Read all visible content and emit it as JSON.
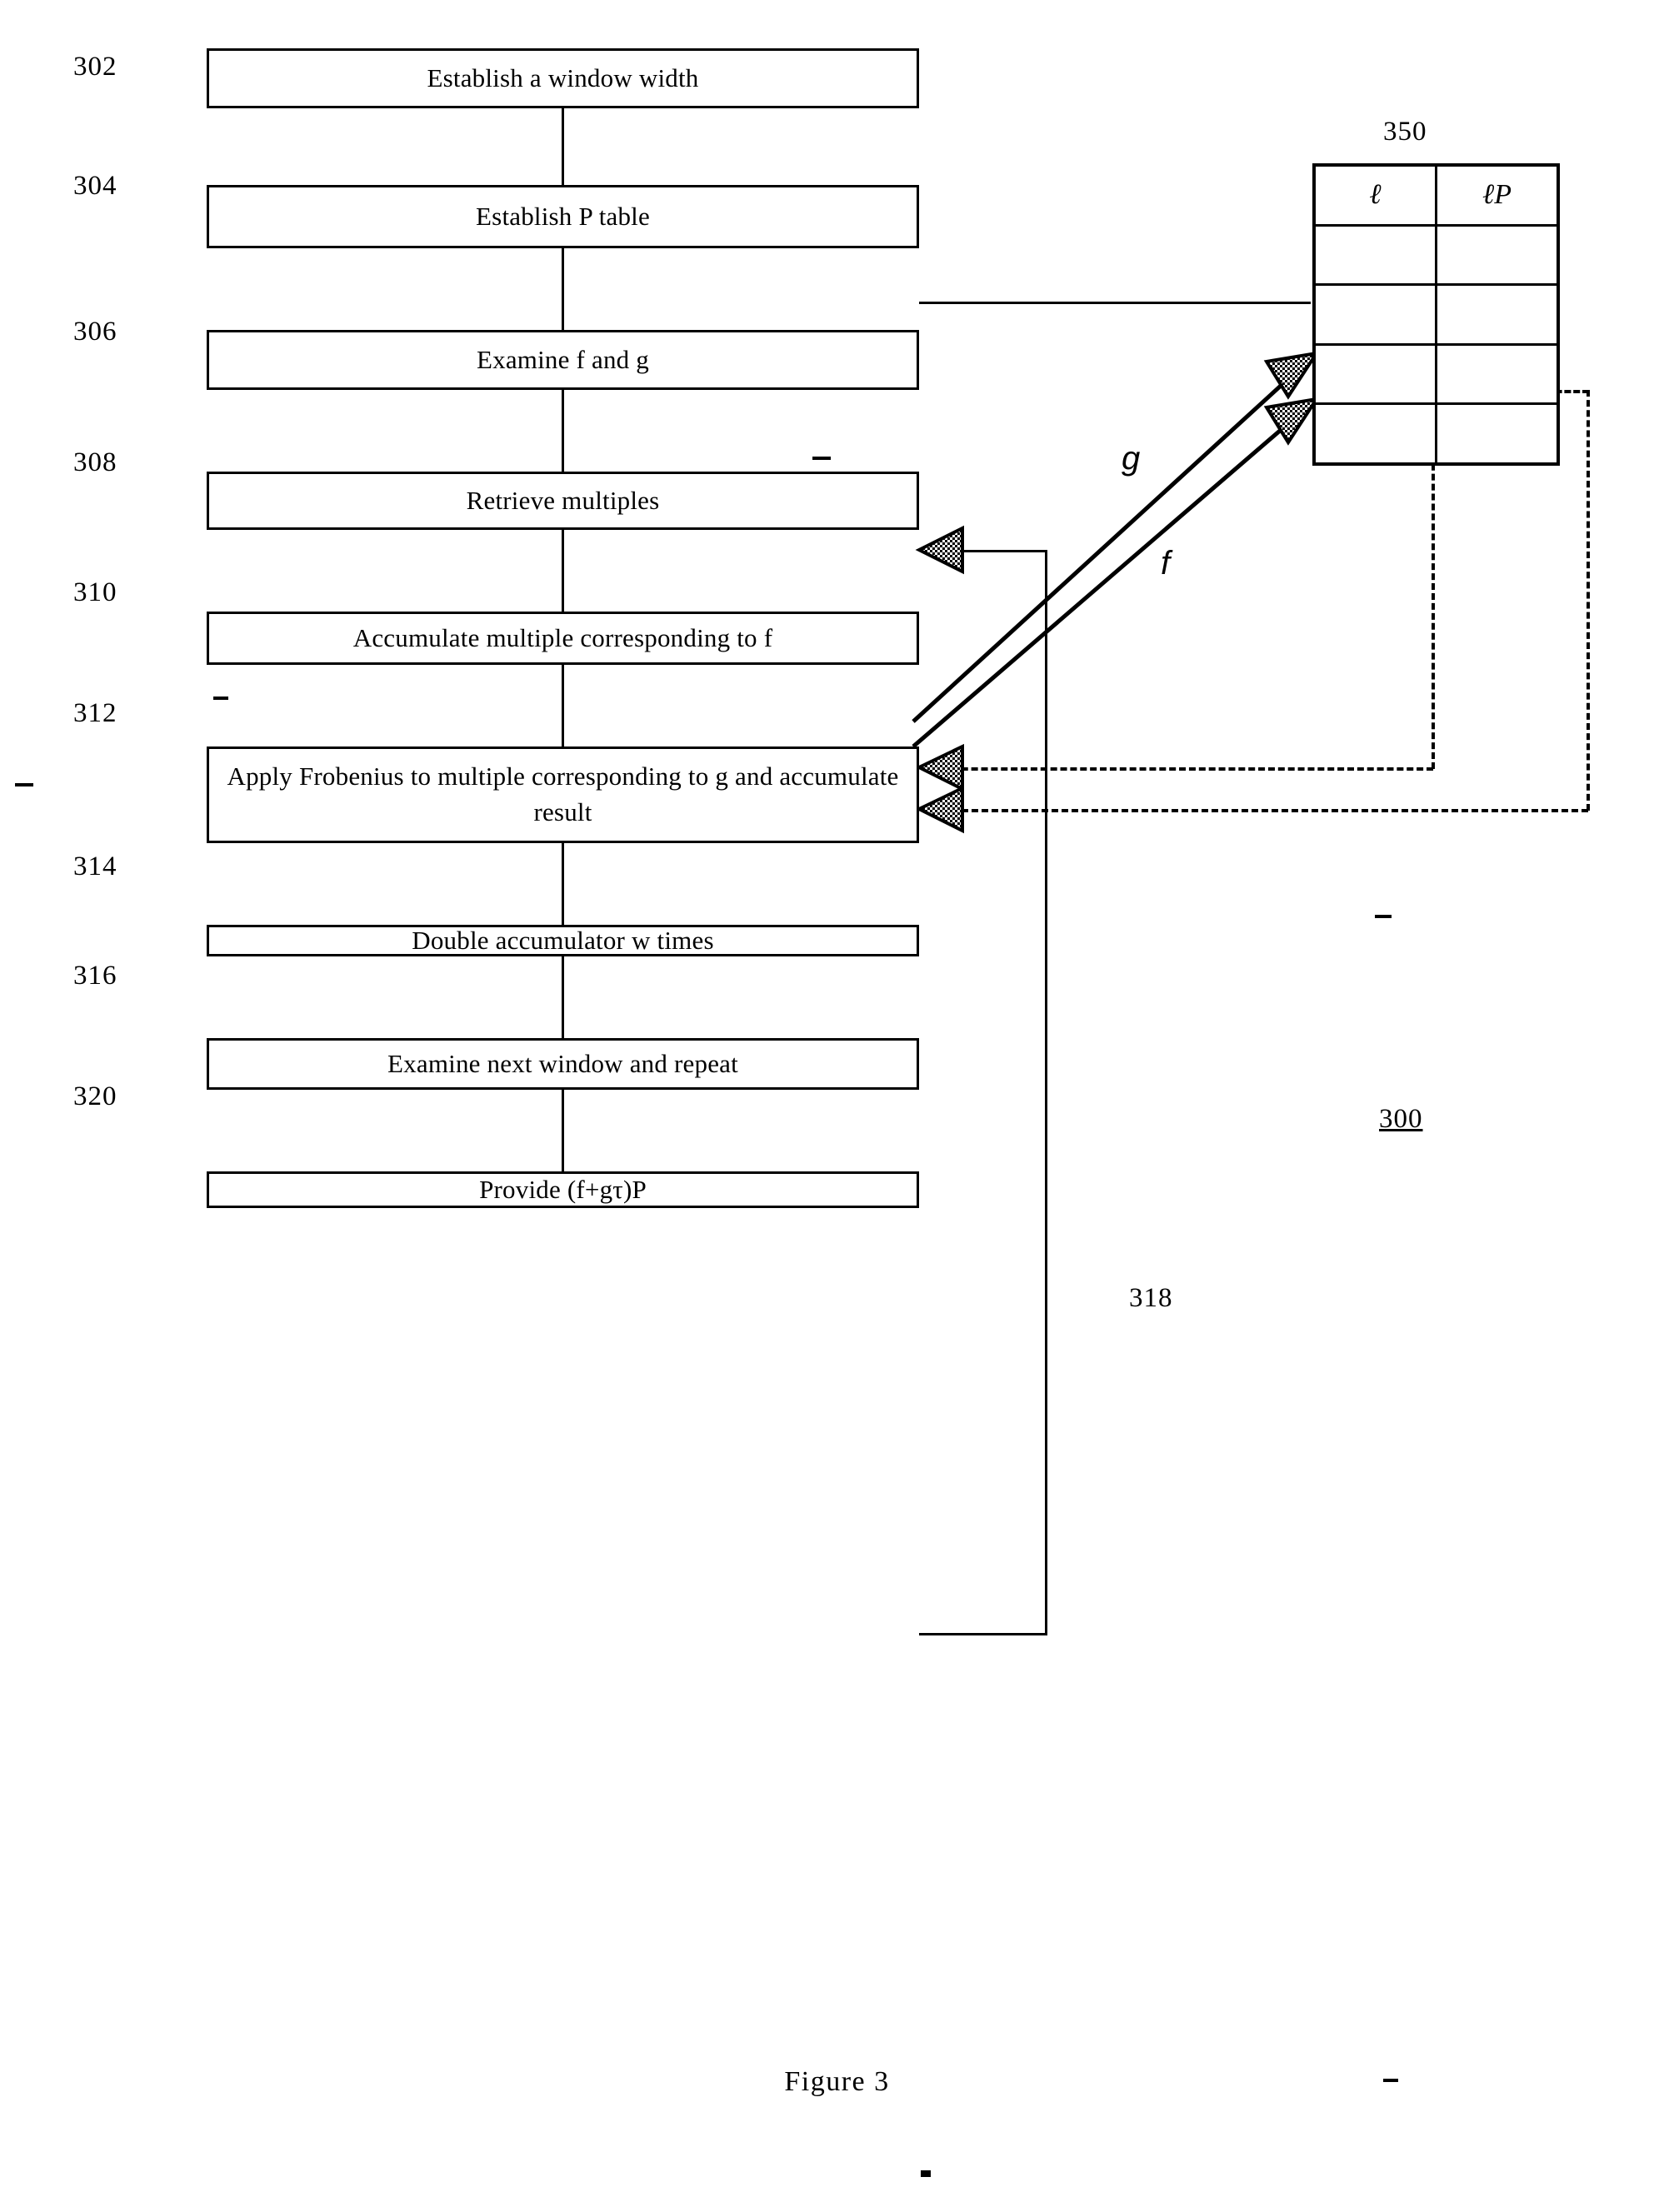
{
  "figure": {
    "caption": "Figure 3",
    "diagram_label": "300"
  },
  "flow_steps": [
    {
      "ref": "302",
      "text": "Establish a window width"
    },
    {
      "ref": "304",
      "text": "Establish P table"
    },
    {
      "ref": "306",
      "text": "Examine f and g"
    },
    {
      "ref": "308",
      "text": "Retrieve multiples"
    },
    {
      "ref": "310",
      "text": "Accumulate multiple corresponding to f"
    },
    {
      "ref": "312",
      "text": "Apply Frobenius to multiple corresponding to g and accumulate result"
    },
    {
      "ref": "314",
      "text": "Double accumulator w times"
    },
    {
      "ref": "316",
      "text": "Examine next window and repeat"
    },
    {
      "ref": "320",
      "text": "Provide (f+gτ)P"
    }
  ],
  "table": {
    "label": "350",
    "headers": [
      "ℓ",
      "ℓP"
    ],
    "empty_rows": 4
  },
  "connectors": {
    "feedback_label": "318",
    "arrow_g_label": "g",
    "arrow_f_label": "f"
  }
}
